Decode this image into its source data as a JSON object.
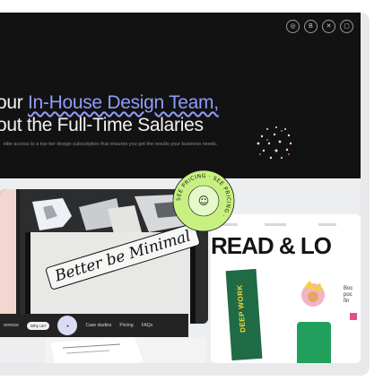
{
  "hero": {
    "headline_prefix": "our ",
    "headline_accent": "In-House Design Team,",
    "headline_line2": "out the Full-Time Salaries",
    "subtext": "elite access to a top-tier design subscription that ensures you get the results your business needs.",
    "social_icons": [
      "dribbble-icon",
      "behance-icon",
      "x-icon",
      "instagram-icon"
    ]
  },
  "badge": {
    "ring_text": "SEE PRICING · SEE PRICING ·",
    "glyph": "☺"
  },
  "showcase": {
    "sticker_text": "Better be Minimal",
    "nav": {
      "links": [
        "rerence",
        "Case studies",
        "Pricing",
        "FAQs"
      ],
      "cta_label": "Why us?"
    },
    "magazine": {
      "title": "READ & LO",
      "book_label": "DEEP WORK",
      "side_text": "Boc poc fin"
    }
  },
  "colors": {
    "hero_bg": "#121212",
    "accent_purple": "#8e9dfc",
    "badge_green": "#c8f080"
  }
}
